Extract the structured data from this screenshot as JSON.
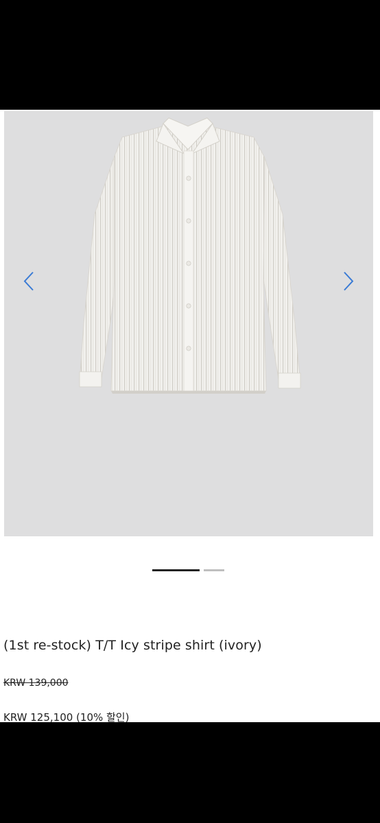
{
  "gallery": {
    "image_alt": "shirt-image",
    "prev_icon": "chevron-left-icon",
    "next_icon": "chevron-right-icon",
    "accent_color": "#3a7bd5",
    "slide_count": 2,
    "active_slide": 1
  },
  "product": {
    "title": "(1st re-stock) T/T Icy stripe shirt (ivory)",
    "original_price": "KRW 139,000",
    "sale_price": "KRW 125,100 (10% 할인)"
  }
}
